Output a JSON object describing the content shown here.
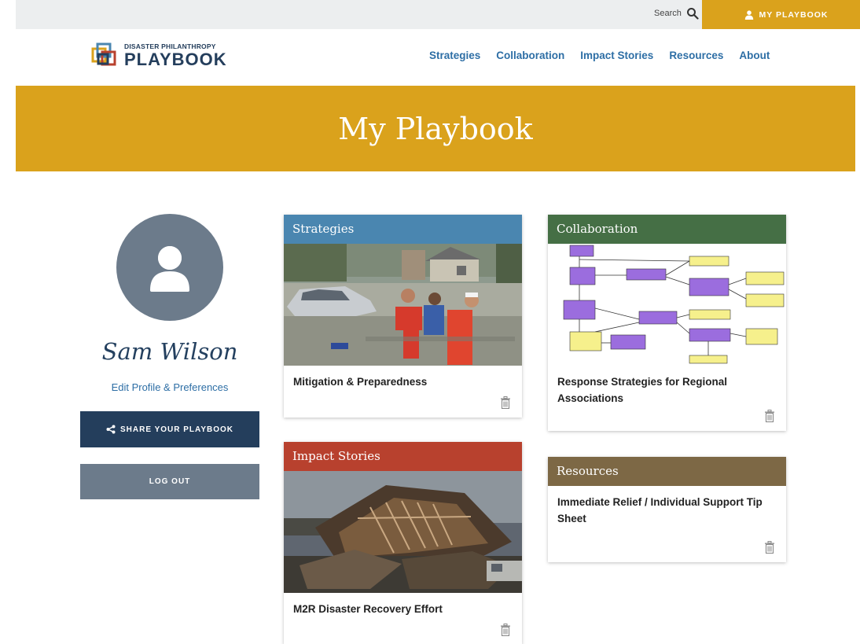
{
  "utility": {
    "search_label": "Search",
    "my_playbook_label": "MY PLAYBOOK"
  },
  "header": {
    "logo_top": "DISASTER PHILANTHROPY",
    "logo_bottom": "PLAYBOOK",
    "nav": [
      "Strategies",
      "Collaboration",
      "Impact Stories",
      "Resources",
      "About"
    ]
  },
  "hero": {
    "title": "My Playbook"
  },
  "profile": {
    "name": "Sam Wilson",
    "edit_link": "Edit Profile & Preferences",
    "share_label": "SHARE YOUR PLAYBOOK",
    "logout_label": "LOG OUT"
  },
  "cards": [
    {
      "category": "Strategies",
      "title": "Mitigation & Preparedness"
    },
    {
      "category": "Impact Stories",
      "title": "M2R Disaster Recovery Effort"
    },
    {
      "category": "Collaboration",
      "title": "Response Strategies for Regional Associations"
    },
    {
      "category": "Resources",
      "title": "Immediate Relief / Individual Support Tip Sheet"
    }
  ],
  "colors": {
    "gold": "#daa21c",
    "navy": "#243e5c",
    "slate": "#6c7b8b",
    "link_blue": "#2d6ea5",
    "strategies": "#4a86b0",
    "impact_stories": "#b8412e",
    "collaboration": "#456f45",
    "resources": "#7d6845"
  },
  "icons": {
    "search": "search-icon",
    "user": "user-icon",
    "share": "share-icon",
    "trash": "trash-icon"
  }
}
